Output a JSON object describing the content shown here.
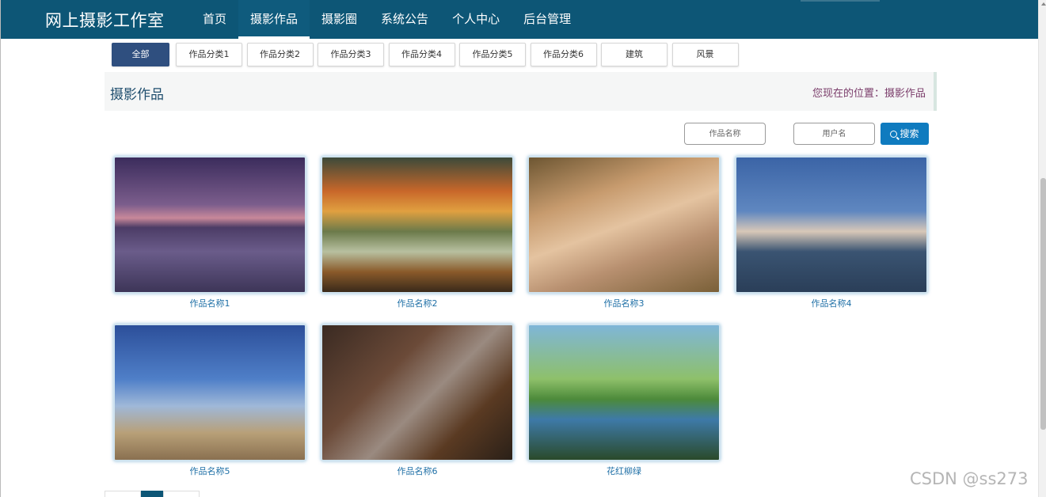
{
  "header": {
    "brand": "网上摄影工作室",
    "nav": [
      "首页",
      "摄影作品",
      "摄影圈",
      "系统公告",
      "个人中心",
      "后台管理"
    ],
    "active_nav": "摄影作品"
  },
  "categories": [
    "全部",
    "作品分类1",
    "作品分类2",
    "作品分类3",
    "作品分类4",
    "作品分类5",
    "作品分类6",
    "建筑",
    "风景"
  ],
  "section": {
    "title": "摄影作品",
    "breadcrumb": "您现在的位置：摄影作品"
  },
  "search": {
    "work_name_placeholder": "作品名称",
    "username_placeholder": "用户名",
    "button_label": "搜索"
  },
  "works": [
    {
      "title": "作品名称1",
      "image": "lake-sunset-silhouette"
    },
    {
      "title": "作品名称2",
      "image": "autumn-bridge-reflection"
    },
    {
      "title": "作品名称3",
      "image": "deer-in-forest"
    },
    {
      "title": "作品名称4",
      "image": "wavy-roof-building"
    },
    {
      "title": "作品名称5",
      "image": "chick-with-birds"
    },
    {
      "title": "作品名称6",
      "image": "man-with-eagle"
    },
    {
      "title": "花红柳绿",
      "image": "willow-park-pond"
    }
  ],
  "watermark": "CSDN @ss273",
  "colors": {
    "header_bg": "#0d5676",
    "active_category": "#2f4f7f",
    "search_button": "#0f7bbf",
    "link": "#1e6fa6"
  }
}
